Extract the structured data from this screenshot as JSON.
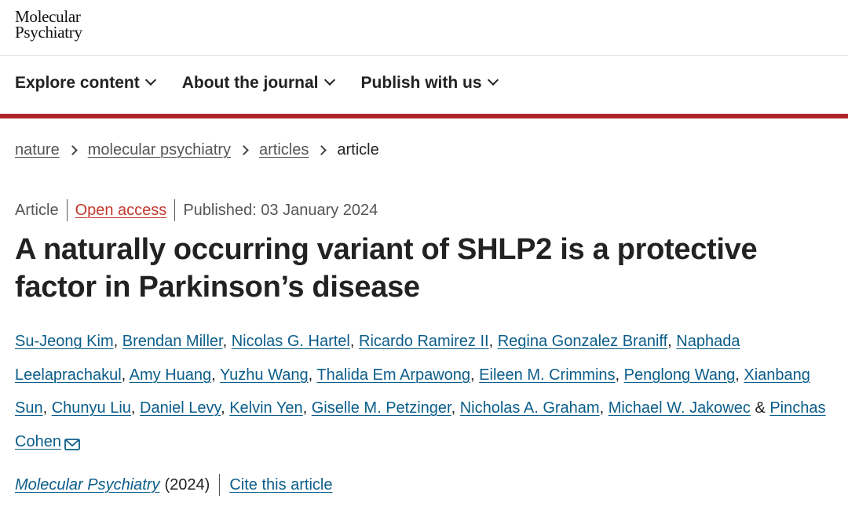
{
  "site": {
    "logo_line1": "Molecular",
    "logo_line2": "Psychiatry"
  },
  "nav": {
    "items": [
      {
        "label": "Explore content"
      },
      {
        "label": "About the journal"
      },
      {
        "label": "Publish with us"
      }
    ],
    "accent_color": "#b0232c"
  },
  "breadcrumb": {
    "items": [
      "nature",
      "molecular psychiatry",
      "articles"
    ],
    "current": "article"
  },
  "article": {
    "type": "Article",
    "access": "Open access",
    "published": "Published: 03 January 2024",
    "title": "A naturally occurring variant of SHLP2 is a protective factor in Parkinson’s disease",
    "authors": [
      "Su-Jeong Kim",
      "Brendan Miller",
      "Nicolas G. Hartel",
      "Ricardo Ramirez II",
      "Regina Gonzalez Braniff",
      "Naphada Leelaprachakul",
      "Amy Huang",
      "Yuzhu Wang",
      "Thalida Em Arpawong",
      "Eileen M. Crimmins",
      "Penglong Wang",
      "Xianbang Sun",
      "Chunyu Liu",
      "Daniel Levy",
      "Kelvin Yen",
      "Giselle M. Petzinger",
      "Nicholas A. Graham",
      "Michael W. Jakowec",
      "Pinchas Cohen"
    ],
    "ampersand": "&",
    "journal": "Molecular Psychiatry",
    "year": "(2024)",
    "cite_label": "Cite this article"
  },
  "colors": {
    "link": "#0b5d8a",
    "open_access": "#c0392b"
  },
  "icons": {
    "corresponding_author": "mail-icon"
  }
}
